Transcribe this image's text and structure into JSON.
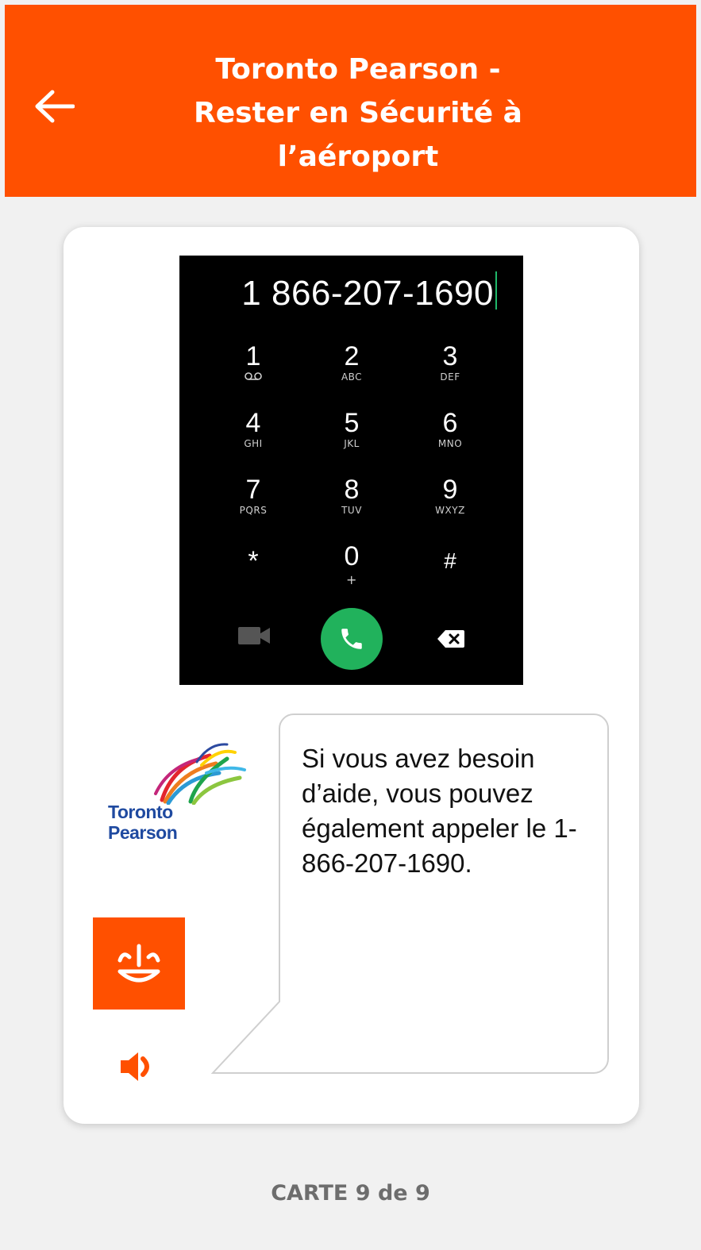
{
  "header": {
    "title_line1": "Toronto Pearson -",
    "title_line2": "Rester en Sécurité à",
    "title_line3": "l’aéroport",
    "background": "#ff5000",
    "back_icon": "arrow-left-icon"
  },
  "dialer": {
    "number": "1 866-207-1690",
    "keys": [
      {
        "digit": "1",
        "letters": ""
      },
      {
        "digit": "2",
        "letters": "ABC"
      },
      {
        "digit": "3",
        "letters": "DEF"
      },
      {
        "digit": "4",
        "letters": "GHI"
      },
      {
        "digit": "5",
        "letters": "JKL"
      },
      {
        "digit": "6",
        "letters": "MNO"
      },
      {
        "digit": "7",
        "letters": "PQRS"
      },
      {
        "digit": "8",
        "letters": "TUV"
      },
      {
        "digit": "9",
        "letters": "WXYZ"
      },
      {
        "digit": "*",
        "letters": ""
      },
      {
        "digit": "0",
        "letters": "+"
      },
      {
        "digit": "#",
        "letters": ""
      }
    ],
    "call_color": "#21b25c",
    "icons": [
      "voicemail-icon",
      "video-call-icon",
      "phone-icon",
      "backspace-icon"
    ]
  },
  "logo": {
    "line1": "Toronto",
    "line2": "Pearson"
  },
  "bubble": {
    "text": "Si vous avez besoin d’aide, vous pouvez également appeler le 1-866-207-1690."
  },
  "footer": {
    "card_counter": "CARTE 9 de 9"
  }
}
